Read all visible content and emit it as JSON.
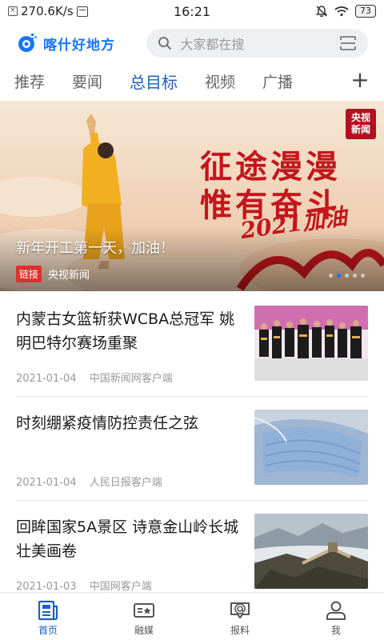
{
  "status_bar": {
    "network_speed": "270.6K/s",
    "time": "16:21",
    "battery": "73"
  },
  "header": {
    "app_name": "喀什好地方",
    "search_placeholder": "大家都在搜"
  },
  "tabs": [
    {
      "label": "推荐",
      "active": false
    },
    {
      "label": "要闻",
      "active": false
    },
    {
      "label": "总目标",
      "active": true
    },
    {
      "label": "视频",
      "active": false
    },
    {
      "label": "广播",
      "active": false
    }
  ],
  "banner": {
    "badge_line1": "央视",
    "badge_line2": "新闻",
    "slogan_line1": "征途漫漫",
    "slogan_line2": "惟有奋斗",
    "slogan_script": "2021加油",
    "caption": "新年开工第一天，加油！",
    "tag": "链接",
    "source": "央视新闻",
    "active_slide": 2,
    "slide_count": 5
  },
  "news": [
    {
      "title": "内蒙古女篮斩获WCBA总冠军 姚明巴特尔赛场重聚",
      "date": "2021-01-04",
      "source": "中国新闻网客户端",
      "thumb": "team-celebration-photo"
    },
    {
      "title": "时刻绷紧疫情防控责任之弦",
      "date": "2021-01-04",
      "source": "人民日报客户端",
      "thumb": "face-mask-photo"
    },
    {
      "title": "回眸国家5A景区 诗意金山岭长城壮美画卷",
      "date": "2021-01-03",
      "source": "中国网客户端",
      "thumb": "great-wall-photo"
    }
  ],
  "bottom_nav": [
    {
      "label": "首页",
      "icon": "home-news-icon",
      "active": true
    },
    {
      "label": "融媒",
      "icon": "media-icon",
      "active": false
    },
    {
      "label": "报料",
      "icon": "report-icon",
      "active": false
    },
    {
      "label": "我",
      "icon": "user-icon",
      "active": false
    }
  ],
  "colors": {
    "accent": "#1677ff",
    "tab_active": "#1d5fbd",
    "slogan_red": "#c4161c"
  }
}
